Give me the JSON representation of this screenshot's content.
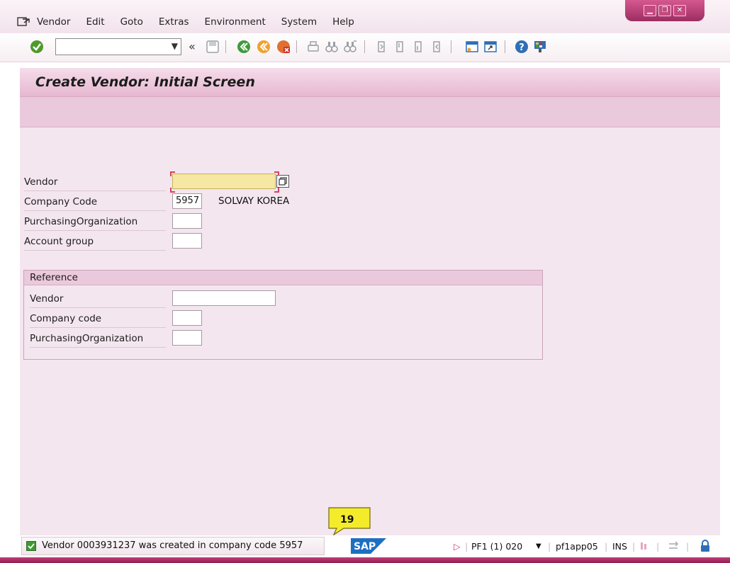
{
  "window": {
    "minimize_glyph": "▁",
    "restore_glyph": "❐",
    "close_glyph": "✕"
  },
  "menu": {
    "icon": "menu-window-icon",
    "items": [
      "Vendor",
      "Edit",
      "Goto",
      "Extras",
      "Environment",
      "System",
      "Help"
    ]
  },
  "toolbar": {
    "command_field": {
      "value": "",
      "dropdown_glyph": "▼"
    },
    "collapse_glyph": "«",
    "icons": [
      "enter-icon",
      "save-icon",
      "back-icon",
      "exit-icon",
      "cancel-icon",
      "print-icon",
      "find-icon",
      "find-next-icon",
      "first-page-icon",
      "previous-page-icon",
      "next-page-icon",
      "last-page-icon",
      "create-session-icon",
      "shortcut-icon",
      "help-icon",
      "customize-layout-icon"
    ]
  },
  "page": {
    "title": "Create Vendor: Initial Screen"
  },
  "form": {
    "vendor": {
      "label": "Vendor",
      "value": ""
    },
    "company_code": {
      "label": "Company Code",
      "value": "5957",
      "description": "SOLVAY KOREA"
    },
    "purchasing_org": {
      "label": "PurchasingOrganization",
      "value": ""
    },
    "account_group": {
      "label": "Account group",
      "value": ""
    }
  },
  "reference": {
    "title": "Reference",
    "vendor": {
      "label": "Vendor",
      "value": ""
    },
    "company_code": {
      "label": "Company code",
      "value": ""
    },
    "purchasing_org": {
      "label": "PurchasingOrganization",
      "value": ""
    }
  },
  "status": {
    "message": "Vendor 0003931237 was created in company code 5957",
    "callout_number": "19",
    "logo": "SAP",
    "system": "PF1 (1) 020",
    "server": "pf1app05",
    "mode": "INS"
  },
  "colors": {
    "accent": "#b83a72",
    "title_band": "#e6b8d1",
    "content_bg": "#f4e6ef",
    "required_field": "#f6e7a3",
    "success": "#3d9a2f",
    "callout": "#f4ec2b"
  }
}
